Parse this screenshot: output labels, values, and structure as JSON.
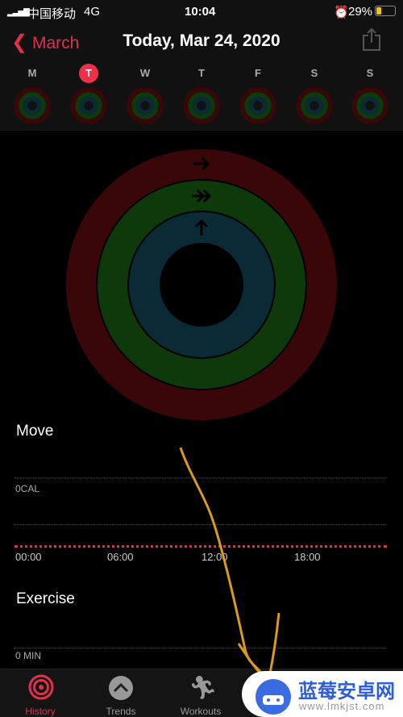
{
  "status": {
    "carrier": "中国移动",
    "network": "4G",
    "time": "10:04",
    "battery": "29%"
  },
  "nav": {
    "back_label": "March",
    "title": "Today, Mar 24, 2020"
  },
  "week": {
    "days": [
      "M",
      "T",
      "W",
      "T",
      "F",
      "S",
      "S"
    ],
    "selected_index": 1
  },
  "rings": {
    "move_color": "#3a0709",
    "exercise_color": "#0e3a0b",
    "stand_color": "#0a2b36"
  },
  "move": {
    "title": "Move",
    "value_label": "0CAL",
    "ticks": [
      "00:00",
      "06:00",
      "12:00",
      "18:00"
    ],
    "goal_line_color": "#e0303a"
  },
  "exercise": {
    "title": "Exercise",
    "value_label": "0 MIN"
  },
  "tabs": [
    {
      "label": "History",
      "active": true
    },
    {
      "label": "Trends"
    },
    {
      "label": "Workouts"
    }
  ],
  "watermark": {
    "name": "蓝莓安卓网",
    "url": "www.lmkjst.com"
  }
}
